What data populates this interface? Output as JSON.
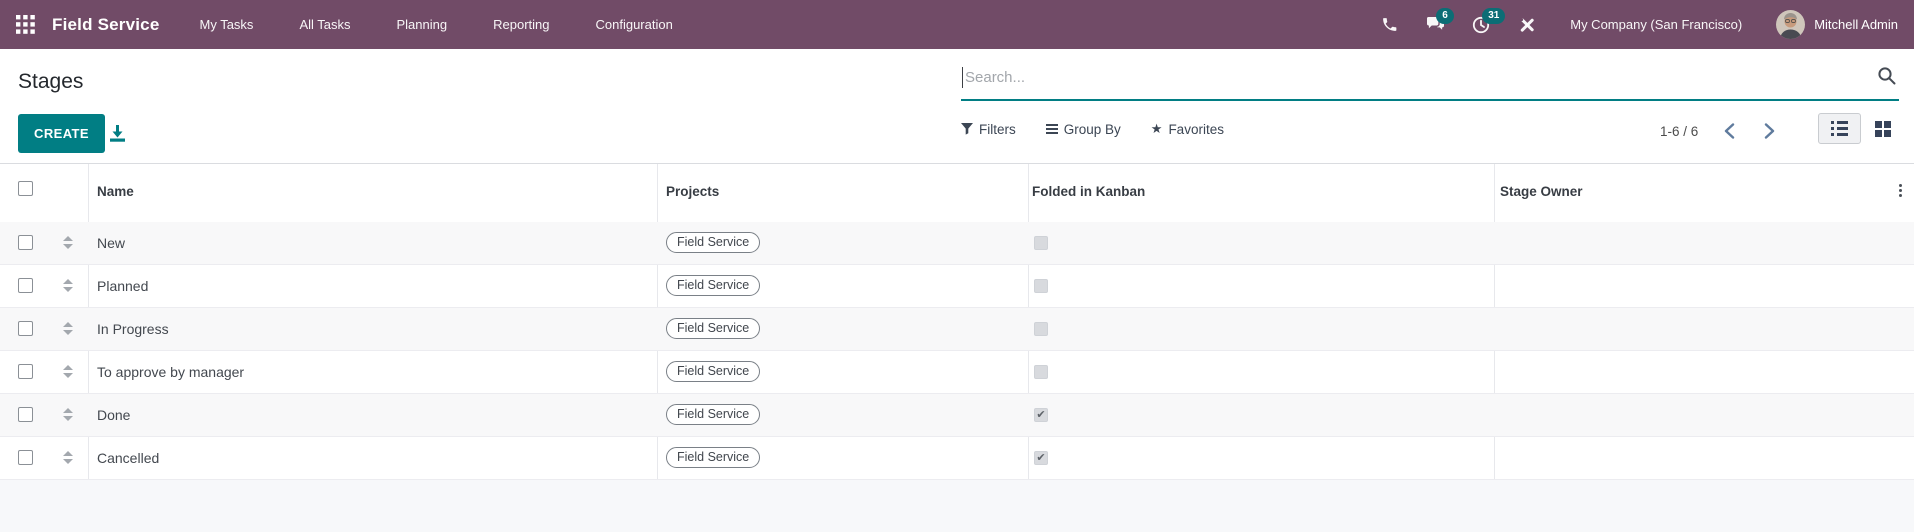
{
  "navbar": {
    "app_name": "Field Service",
    "menu_items": [
      "My Tasks",
      "All Tasks",
      "Planning",
      "Reporting",
      "Configuration"
    ],
    "messages_count": "6",
    "activities_count": "31",
    "company": "My Company (San Francisco)",
    "user": "Mitchell Admin"
  },
  "control_panel": {
    "title": "Stages",
    "create_label": "CREATE",
    "search_placeholder": "Search...",
    "filters_label": "Filters",
    "group_by_label": "Group By",
    "favorites_label": "Favorites",
    "pager_text": "1-6 / 6"
  },
  "table": {
    "columns": [
      "Name",
      "Projects",
      "Folded in Kanban",
      "Stage Owner"
    ],
    "rows": [
      {
        "name": "New",
        "project": "Field Service",
        "folded": false,
        "stage_owner": ""
      },
      {
        "name": "Planned",
        "project": "Field Service",
        "folded": false,
        "stage_owner": ""
      },
      {
        "name": "In Progress",
        "project": "Field Service",
        "folded": false,
        "stage_owner": ""
      },
      {
        "name": "To approve by manager",
        "project": "Field Service",
        "folded": false,
        "stage_owner": ""
      },
      {
        "name": "Done",
        "project": "Field Service",
        "folded": true,
        "stage_owner": ""
      },
      {
        "name": "Cancelled",
        "project": "Field Service",
        "folded": true,
        "stage_owner": ""
      }
    ],
    "check_glyph": "✔"
  },
  "icons": {
    "apps": "apps-grid-icon",
    "phone": "phone-icon",
    "chat": "chat-bubbles-icon",
    "activity": "clock-icon",
    "tools": "crossed-tools-icon",
    "search": "search-icon",
    "filter": "funnel-icon",
    "group_by": "group-by-lines-icon",
    "favorites": "star-icon",
    "export": "download-icon",
    "list_view": "list-view-icon",
    "kanban_view": "kanban-view-icon",
    "favorites_star": "★",
    "pager_prev": "chevron-left-icon",
    "pager_next": "chevron-right-icon"
  },
  "colors": {
    "navbar_bg": "#714B67",
    "accent_teal": "#017E84",
    "badge_bg": "#0C6D75",
    "icon_dark": "#36435A",
    "chevron_blue": "#5F7B9D",
    "row_stripe": "#F8F8F9"
  }
}
